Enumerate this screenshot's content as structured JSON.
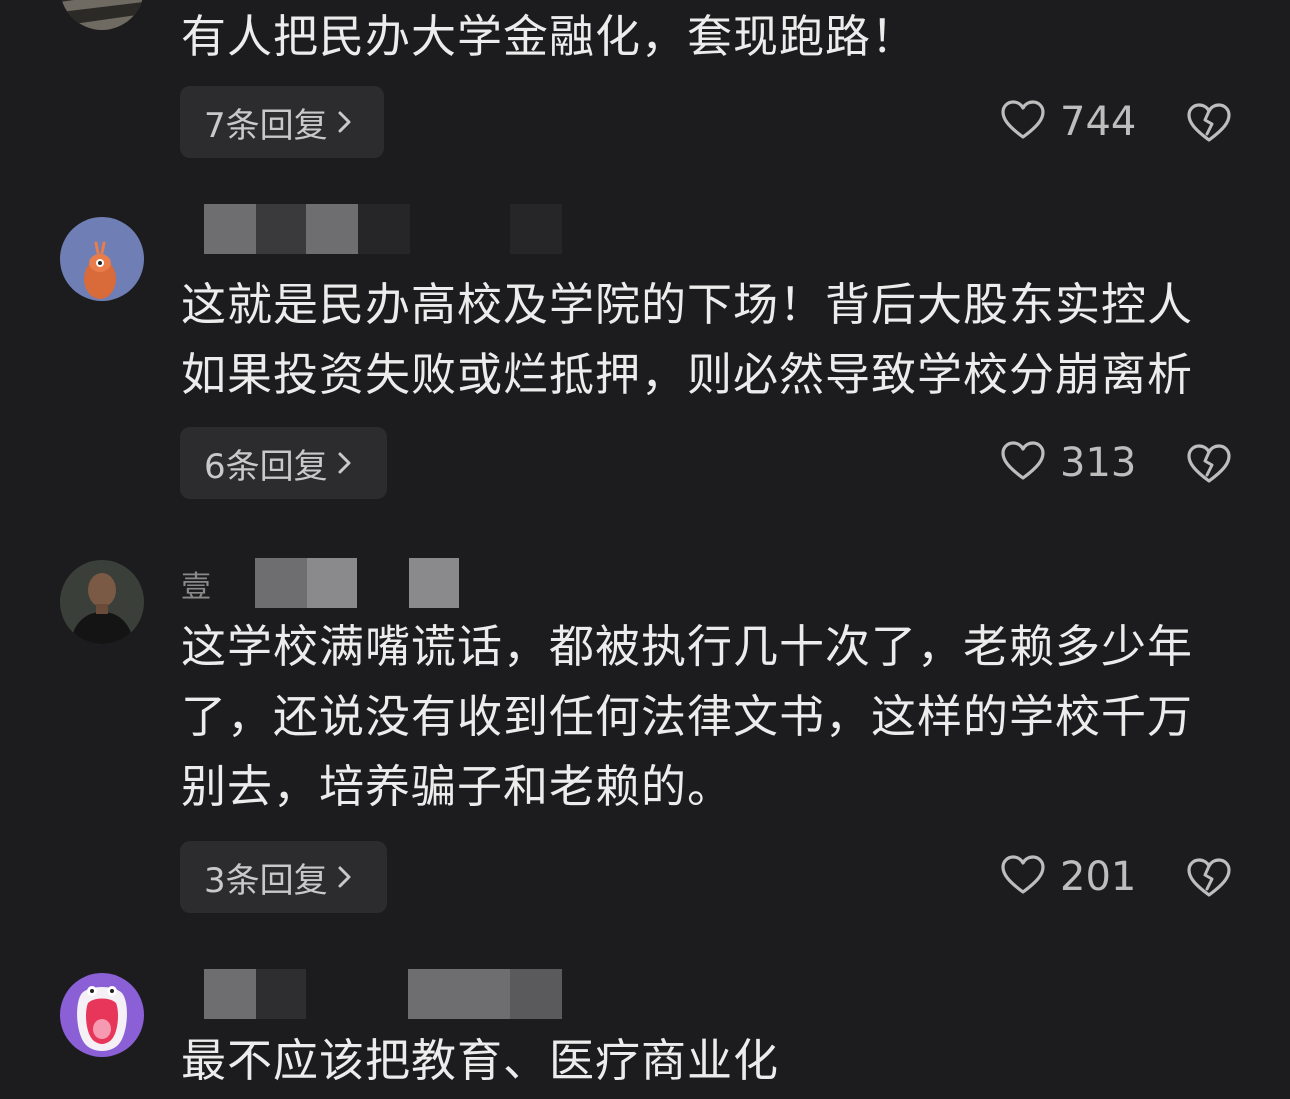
{
  "comments": [
    {
      "text": "有人把民办大学金融化，套现跑路！",
      "reply_label": "7条回复",
      "likes": "744",
      "avatar_icon": "zebra-avatar-icon"
    },
    {
      "text_lines": [
        "这就是民办高校及学院的下场！背后大股东实控人",
        "如果投资失败或烂抵押，则必然导致学校分崩离析"
      ],
      "reply_label": "6条回复",
      "likes": "313",
      "avatar_icon": "cartoon-avatar-icon"
    },
    {
      "name_visible_char": "壹",
      "text_lines": [
        "这学校满嘴谎话，都被执行几十次了，老赖多少年",
        "了，还说没有收到任何法律文书，这样的学校千万",
        "别去，培养骗子和老赖的。"
      ],
      "reply_label": "3条回复",
      "likes": "201",
      "avatar_icon": "photo-avatar-icon"
    },
    {
      "text": "最不应该把教育、医疗商业化",
      "avatar_icon": "monster-avatar-icon"
    }
  ],
  "colors": {
    "background": "#1c1c1e",
    "button_bg": "#2c2c2e",
    "text": "#ececec",
    "muted": "#bdbdbd"
  }
}
